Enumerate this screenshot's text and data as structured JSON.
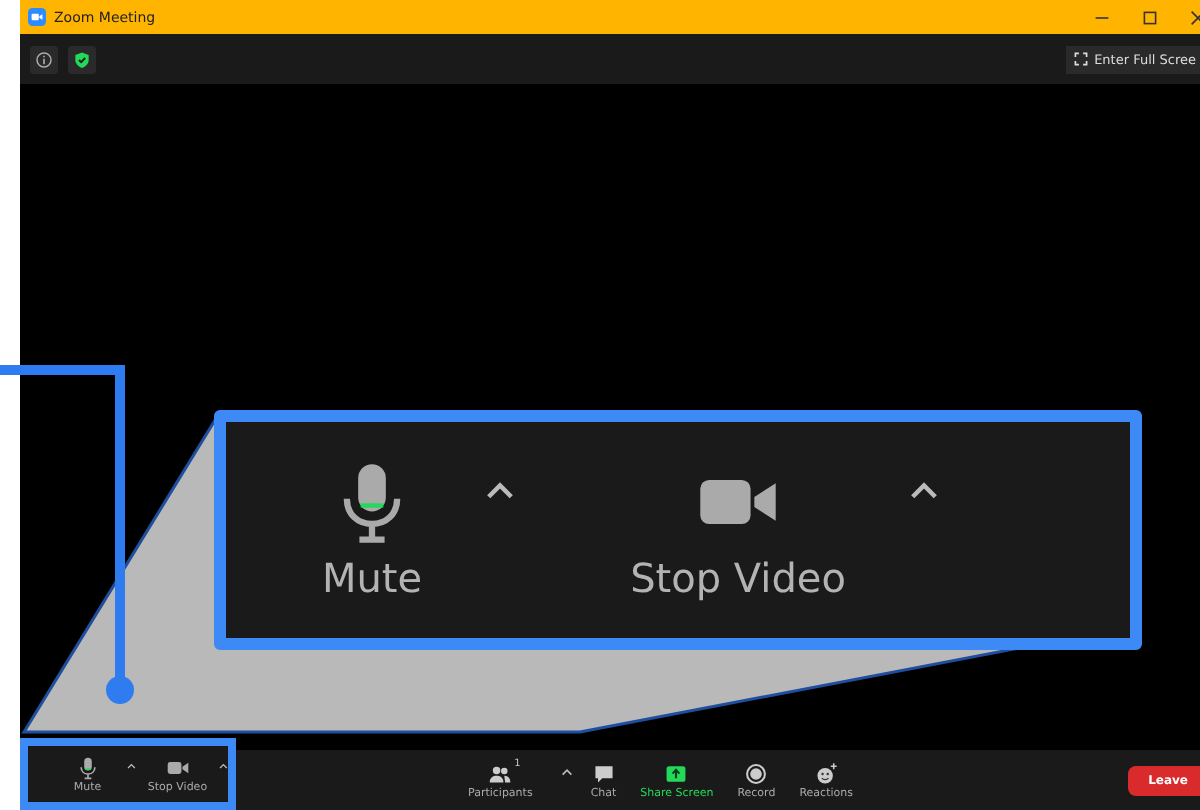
{
  "window": {
    "title": "Zoom Meeting"
  },
  "top_bar": {
    "fullscreen_button": "Enter Full Scree"
  },
  "toolbar": {
    "left": [
      {
        "kind": "mic",
        "label": "Mute",
        "has_menu": true
      },
      {
        "kind": "video",
        "label": "Stop Video",
        "has_menu": true
      }
    ],
    "center": [
      {
        "kind": "participants",
        "label": "Participants",
        "badge": "1",
        "has_menu": true
      },
      {
        "kind": "chat",
        "label": "Chat",
        "has_menu": false
      },
      {
        "kind": "share",
        "label": "Share Screen",
        "has_menu": false
      },
      {
        "kind": "record",
        "label": "Record",
        "has_menu": false
      },
      {
        "kind": "reactions",
        "label": "Reactions",
        "has_menu": false
      }
    ],
    "leave_button": "Leave"
  },
  "callout": {
    "items": [
      {
        "kind": "mic",
        "label": "Mute",
        "has_menu": true
      },
      {
        "kind": "video",
        "label": "Stop Video",
        "has_menu": true
      }
    ]
  }
}
